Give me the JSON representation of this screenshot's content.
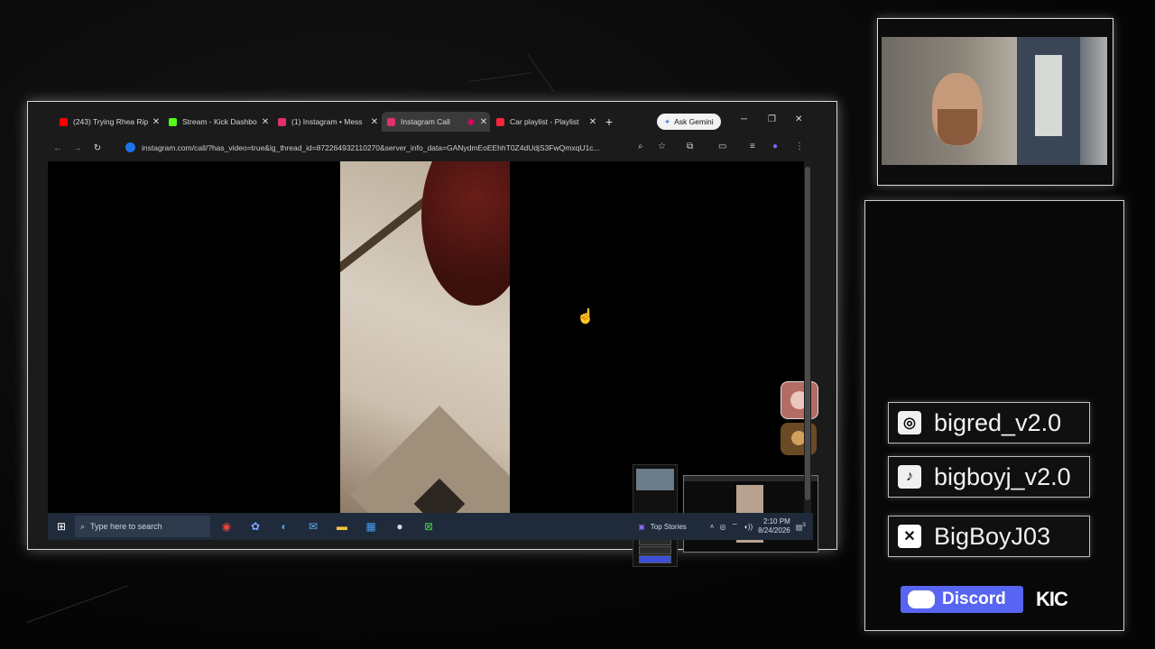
{
  "browser": {
    "tabs": [
      {
        "title": "(243) Trying Rhea Rip",
        "favicon": "youtube-icon",
        "color": "#ff0000"
      },
      {
        "title": "Stream - Kick Dashbo",
        "favicon": "kick-icon",
        "color": "#53fc18"
      },
      {
        "title": "(1) Instagram • Mess",
        "favicon": "instagram-icon",
        "color": "#e1306c"
      },
      {
        "title": "Instagram Call",
        "favicon": "instagram-icon",
        "color": "#e1306c",
        "active": true
      },
      {
        "title": "Car playlist - Playlist",
        "favicon": "music-icon",
        "color": "#fa243c"
      }
    ],
    "ask_gemini": "Ask Gemini",
    "url": "instagram.com/call/?has_video=true&ig_thread_id=872264932110270&server_info_data=GANydmEoEEhhT0Z4dUdjS3FwQmxqU1c..."
  },
  "taskbar": {
    "search_placeholder": "Type here to search",
    "news": "Top Stories",
    "time": "2:10 PM",
    "date": "8/24/2026",
    "notification_count": "3"
  },
  "overlay": {
    "instagram": "bigred_v2.0",
    "tiktok": "bigboyj_v2.0",
    "x": "BigBoyJ03",
    "discord": "Discord",
    "kick": "KIC"
  },
  "colors": {
    "accent_discord": "#5865f2",
    "taskbar": "#1f2a3a"
  }
}
